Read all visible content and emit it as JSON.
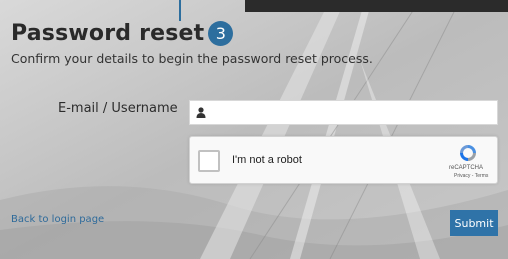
{
  "header": {
    "title": "Password reset",
    "step_number": "3",
    "subtitle": "Confirm your details to begin the password reset process."
  },
  "form": {
    "username_label": "E-mail / Username",
    "username_value": "",
    "username_icon": "user-icon"
  },
  "captcha": {
    "label": "I'm not a robot",
    "brand": "reCAPTCHA",
    "links": "Privacy - Terms",
    "checked": false
  },
  "footer": {
    "back_link": "Back to login page",
    "submit_label": "Submit"
  },
  "colors": {
    "accent": "#2f73a8",
    "link": "#2e6a9a"
  }
}
